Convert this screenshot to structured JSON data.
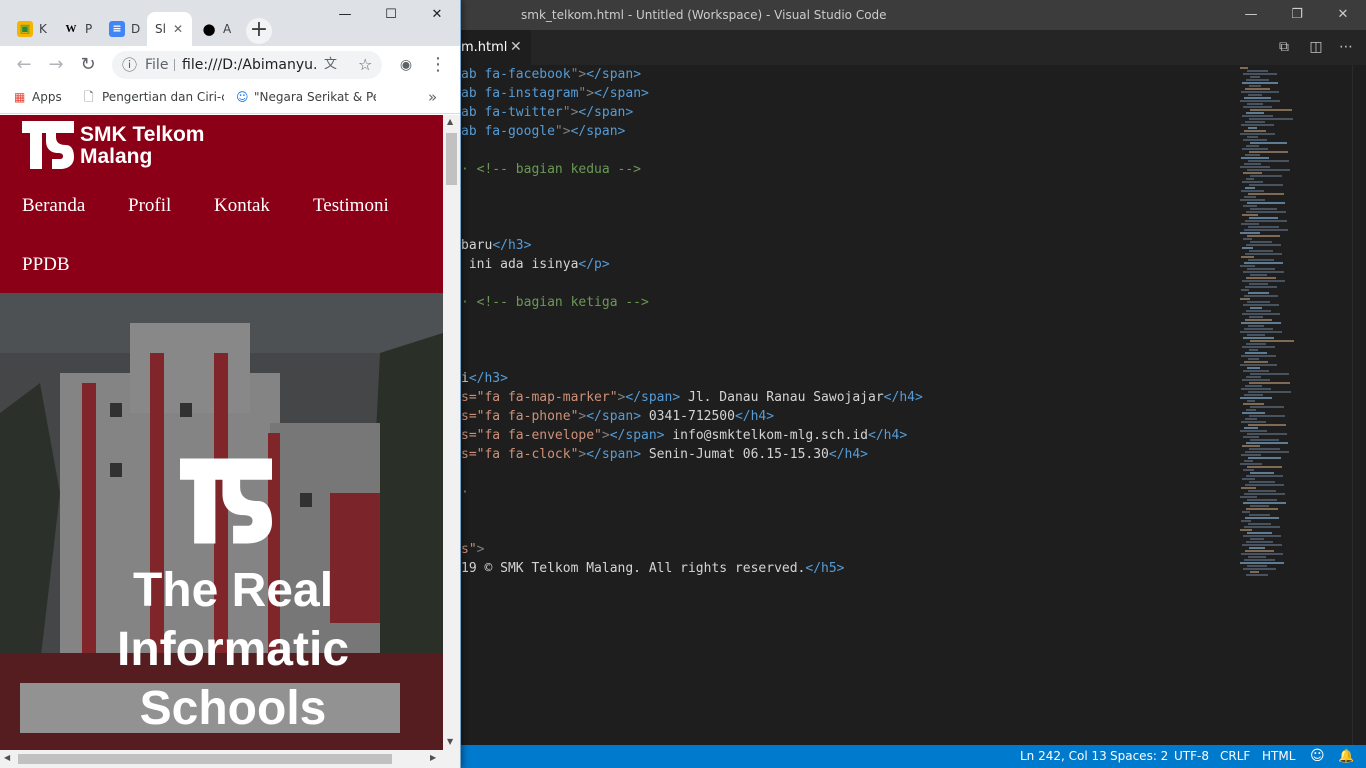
{
  "vscode": {
    "window_title": "smk_telkom.html - Untitled (Workspace) - Visual Studio Code",
    "tab_label": "m.html",
    "lines": [
      {
        "parts": [
          [
            "tag",
            "ab fa-facebook"
          ],
          [
            "punc",
            "\">"
          ],
          [
            "tag",
            "</span>"
          ]
        ]
      },
      {
        "parts": [
          [
            "tag",
            "ab fa-instagram"
          ],
          [
            "punc",
            "\">"
          ],
          [
            "tag",
            "</span>"
          ]
        ]
      },
      {
        "parts": [
          [
            "tag",
            "ab fa-twitter"
          ],
          [
            "punc",
            "\">"
          ],
          [
            "tag",
            "</span>"
          ]
        ]
      },
      {
        "parts": [
          [
            "tag",
            "ab fa-google"
          ],
          [
            "punc",
            "\">"
          ],
          [
            "tag",
            "</span>"
          ]
        ]
      },
      {
        "parts": []
      },
      {
        "parts": [
          [
            "cmt",
            "· <!-- bagian kedua -->"
          ]
        ]
      },
      {
        "parts": []
      },
      {
        "parts": []
      },
      {
        "parts": []
      },
      {
        "parts": [
          [
            "txt",
            "baru"
          ],
          [
            "tag",
            "</h3>"
          ]
        ]
      },
      {
        "parts": [
          [
            "txt",
            " ini ada isinya"
          ],
          [
            "tag",
            "</p>"
          ]
        ]
      },
      {
        "parts": []
      },
      {
        "parts": [
          [
            "cmt",
            "· <!-- bagian ketiga -->"
          ]
        ]
      },
      {
        "parts": []
      },
      {
        "parts": []
      },
      {
        "parts": []
      },
      {
        "parts": [
          [
            "txt",
            "i"
          ],
          [
            "tag",
            "</h3>"
          ]
        ]
      },
      {
        "parts": [
          [
            "str",
            "s=\"fa fa-map-marker\""
          ],
          [
            "punc",
            ">"
          ],
          [
            "tag",
            "</span>"
          ],
          [
            "txt",
            " Jl. Danau Ranau Sawojajar"
          ],
          [
            "tag",
            "</h4>"
          ]
        ]
      },
      {
        "parts": [
          [
            "str",
            "s=\"fa fa-phone\""
          ],
          [
            "punc",
            ">"
          ],
          [
            "tag",
            "</span>"
          ],
          [
            "txt",
            " 0341-712500"
          ],
          [
            "tag",
            "</h4>"
          ]
        ]
      },
      {
        "parts": [
          [
            "str",
            "s=\"fa fa-envelope\""
          ],
          [
            "punc",
            ">"
          ],
          [
            "tag",
            "</span>"
          ],
          [
            "txt",
            " info@smktelkom-mlg.sch.id"
          ],
          [
            "tag",
            "</h4>"
          ]
        ]
      },
      {
        "parts": [
          [
            "str",
            "s=\"fa fa-clock\""
          ],
          [
            "punc",
            ">"
          ],
          [
            "tag",
            "</span>"
          ],
          [
            "txt",
            " Senin-Jumat 06.15-15.30"
          ],
          [
            "tag",
            "</h4>"
          ]
        ]
      },
      {
        "parts": []
      },
      {
        "parts": [
          [
            "punc",
            "·"
          ]
        ]
      },
      {
        "parts": []
      },
      {
        "parts": []
      },
      {
        "parts": [
          [
            "str",
            "s\""
          ],
          [
            "punc",
            ">"
          ]
        ]
      },
      {
        "parts": [
          [
            "txt",
            "19 © SMK Telkom Malang. All rights reserved."
          ],
          [
            "tag",
            "</h5>"
          ]
        ]
      }
    ],
    "status": {
      "position": "Ln 242, Col 13",
      "spaces": "Spaces: 2",
      "encoding": "UTF-8",
      "eol": "CRLF",
      "language": "HTML"
    }
  },
  "chrome": {
    "tabs": [
      {
        "label": "K",
        "icon": "classroom-icon",
        "color": "#f4b400",
        "active": false
      },
      {
        "label": "P",
        "icon": "wikipedia-icon",
        "color": "#ffffff",
        "active": false
      },
      {
        "label": "D",
        "icon": "docs-icon",
        "color": "#4285f4",
        "active": false
      },
      {
        "label": "Sl",
        "icon": "page-icon",
        "color": "#ffffff",
        "active": true
      },
      {
        "label": "A",
        "icon": "github-icon",
        "color": "#ffffff",
        "active": false
      }
    ],
    "omnibox": {
      "scheme": "File",
      "url": "file:///D:/Abimanyu..."
    },
    "bookmarks": [
      {
        "label": "Apps",
        "icon": "apps-icon"
      },
      {
        "label": "Pengertian dan Ciri-ci",
        "icon": "doc-icon"
      },
      {
        "label": "\"Negara Serikat & Pe",
        "icon": "person-icon"
      }
    ]
  },
  "site": {
    "logo_line1": "SMK Telkom",
    "logo_line2": "Malang",
    "nav": [
      "Beranda",
      "Profil",
      "Kontak",
      "Testimoni",
      "PPDB"
    ],
    "hero_line1": "The Real",
    "hero_line2": "Informatic",
    "hero_line3": "Schools"
  }
}
